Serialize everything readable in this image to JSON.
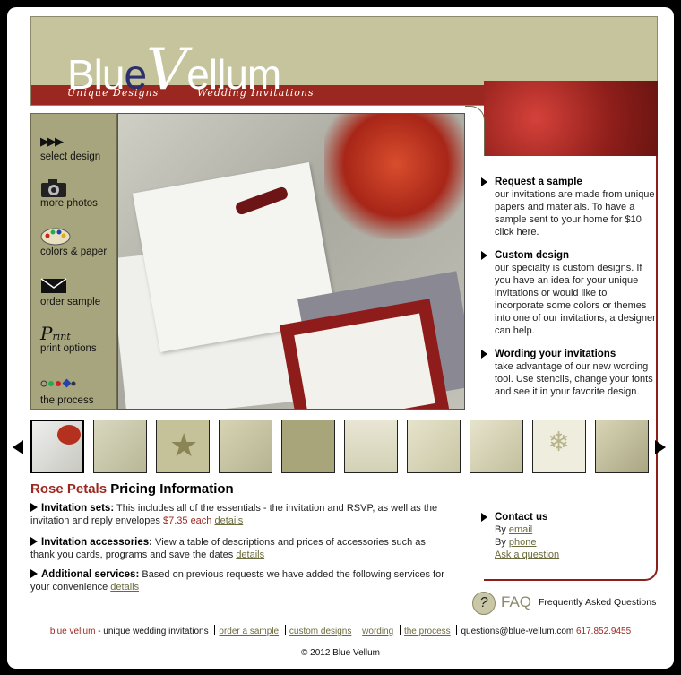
{
  "header": {
    "logo_blue": "Blu",
    "logo_e": "e",
    "logo_v": "V",
    "logo_rest": "ellum",
    "tagline_left": "Unique Designs",
    "tagline_right": "Wedding Invitations"
  },
  "nav": [
    {
      "icon": "play-arrows-icon",
      "glyph": "▶▶▶",
      "label": "select design"
    },
    {
      "icon": "camera-icon",
      "glyph": "📷",
      "label": "more photos"
    },
    {
      "icon": "palette-icon",
      "glyph": "🎨",
      "label": "colors & paper"
    },
    {
      "icon": "envelope-icon",
      "glyph": "✉",
      "label": "order sample"
    },
    {
      "icon": "print-icon",
      "glyph": "P",
      "label": "print options"
    },
    {
      "icon": "process-icon",
      "glyph": "◦◦◆◦",
      "label": "the process"
    }
  ],
  "sidebar": {
    "request": {
      "heading": "Request a sample",
      "text": "our invitations are made from unique papers and materials. To have a sample sent to your home for $10 click here."
    },
    "custom": {
      "heading": "Custom design",
      "text": "our specialty is custom designs. If you have an idea for your unique invitations or would like to incorporate some colors or themes into one of our invitations, a designer can help."
    },
    "wording": {
      "heading": "Wording your invitations",
      "text": "take advantage of our new wording tool. Use stencils, change your fonts and see it in your favorite design."
    },
    "contact": {
      "heading": "Contact us",
      "by1": "By",
      "email": "email",
      "by2": "By",
      "phone": "phone",
      "ask": "Ask a question"
    }
  },
  "pricing": {
    "accent": "Rose Petals",
    "title": "Pricing Information",
    "items": [
      {
        "label": "Invitation sets:",
        "text": " This includes all of the essentials - the invitation and RSVP, as well as the invitation and reply envelopes ",
        "price": "$7.35 each",
        "link": "details"
      },
      {
        "label": "Invitation accessories:",
        "text": " View a table of descriptions and prices of accessories such as thank you cards, programs and save the dates ",
        "link": "details"
      },
      {
        "label": "Additional services:",
        "text": " Based on previous requests we have added the following services for your convenience ",
        "link": "details"
      }
    ]
  },
  "faq": {
    "symbol": "?",
    "label": "FAQ",
    "sub": "Frequently Asked Questions"
  },
  "footer": {
    "brand": "blue vellum",
    "brand_suffix": " - unique wedding invitations",
    "links": [
      "order a sample",
      "custom designs",
      "wording",
      "the process"
    ],
    "email": "questions@blue-vellum.com",
    "phone": "617.852.9455",
    "copyright": "© 2012 Blue Vellum"
  },
  "colors": {
    "olive": "#c5c49c",
    "burgundy": "#9b2820",
    "link": "#6b6a3d"
  }
}
